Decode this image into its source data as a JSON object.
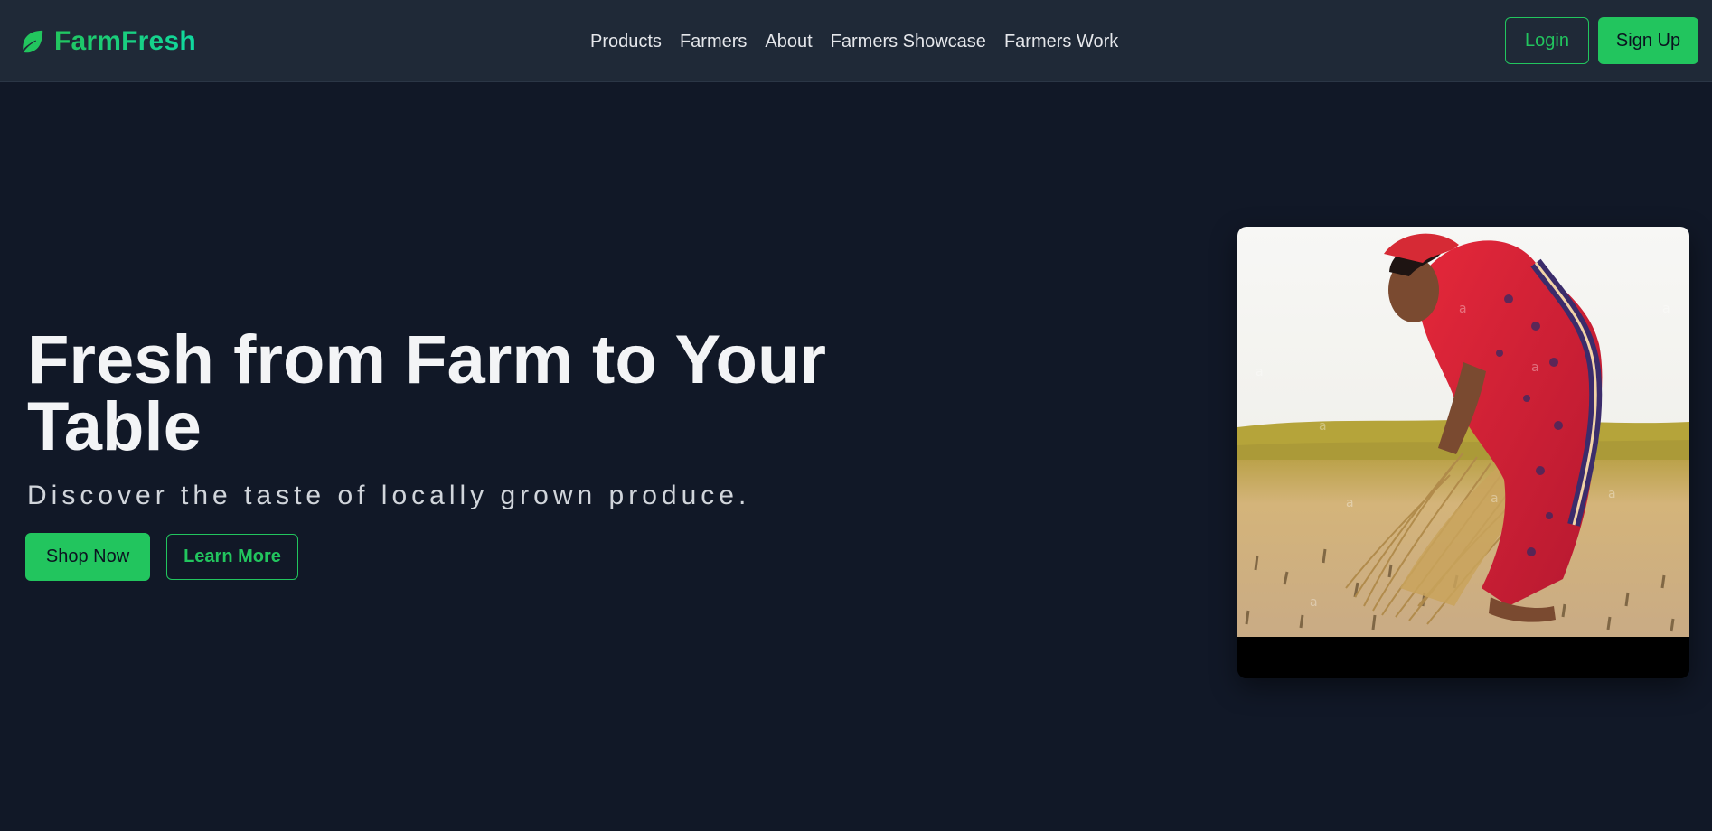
{
  "app": {
    "brand": "FarmFresh"
  },
  "nav": {
    "links": [
      "Products",
      "Farmers",
      "About",
      "Farmers Showcase",
      "Farmers Work"
    ],
    "login": "Login",
    "signup": "Sign Up"
  },
  "hero": {
    "title": "Fresh from Farm to Your Table",
    "subtitle": "Discover the taste of locally grown produce.",
    "primary_cta": "Shop Now",
    "secondary_cta": "Learn More"
  },
  "icons": {
    "brand": "leaf-icon"
  },
  "colors": {
    "accent": "#22c55e",
    "page_background": "#111827",
    "navbar_background": "#1f2937"
  }
}
